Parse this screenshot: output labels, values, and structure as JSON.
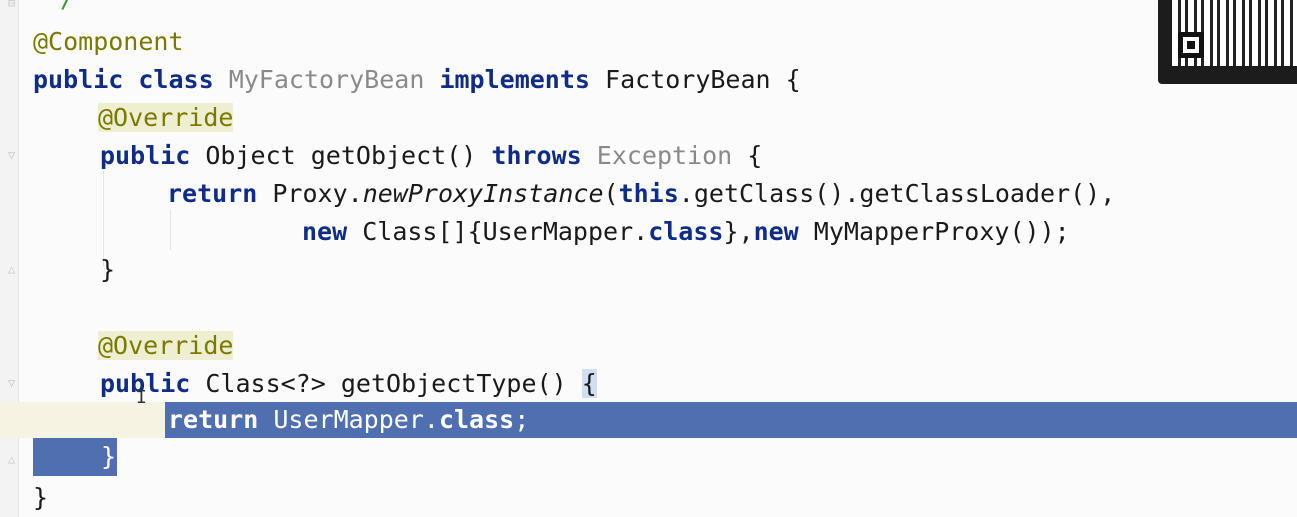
{
  "editor": {
    "lines": {
      "comment_end": "*/",
      "annotation_component": "@Component",
      "class_decl": {
        "kw_public": "public",
        "kw_class": "class",
        "class_name": "MyFactoryBean",
        "kw_implements": "implements",
        "interface": "FactoryBean",
        "brace": "{"
      },
      "override_1": "@Override",
      "get_object_decl": {
        "kw_public": "public",
        "return_type": "Object",
        "method": "getObject()",
        "kw_throws": "throws",
        "exception": "Exception",
        "brace": "{"
      },
      "return_proxy": {
        "kw_return": "return",
        "proxy": "Proxy.",
        "method": "newProxyInstance",
        "open": "(",
        "kw_this": "this",
        "rest": ".getClass().getClassLoader(),"
      },
      "proxy_args": {
        "kw_new": "new",
        "class_arr": "Class[]{UserMapper.",
        "kw_class": "class",
        "close": "},",
        "kw_new2": "new",
        "rest": "MyMapperProxy());"
      },
      "close_brace_1": "}",
      "override_2": "@Override",
      "get_object_type_decl": {
        "kw_public": "public",
        "type": "Class<?>",
        "method": "getObjectType()",
        "brace": "{"
      },
      "return_mapper": {
        "kw_return": "return",
        "text": "UserMapper.",
        "kw_class": "class",
        "semi": ";"
      },
      "close_brace_2": "}",
      "close_brace_class": "}"
    }
  },
  "colors": {
    "keyword": "#0f2d86",
    "annotation": "#7a7a00",
    "selection": "#4f6fb0",
    "background": "#fbfbfb"
  },
  "icons": {
    "qr": "qr-code-icon",
    "fold": "fold-marker-icon",
    "text_cursor": "text-cursor-icon"
  }
}
